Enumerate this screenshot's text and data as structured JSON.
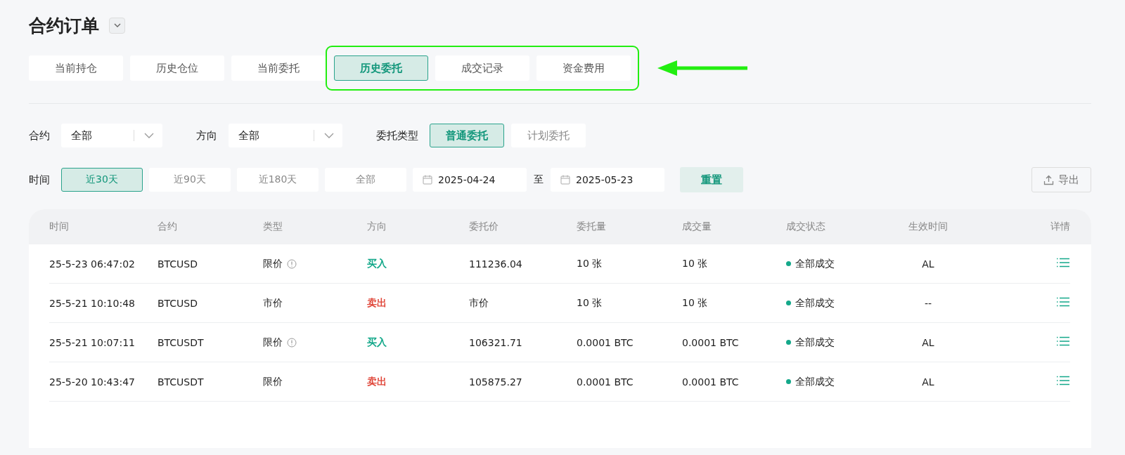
{
  "page_title": "合约订单",
  "tabs": [
    {
      "label": "当前持仓",
      "selected": false,
      "highlighted": false
    },
    {
      "label": "历史仓位",
      "selected": false,
      "highlighted": false
    },
    {
      "label": "当前委托",
      "selected": false,
      "highlighted": false
    },
    {
      "label": "历史委托",
      "selected": true,
      "highlighted": true
    },
    {
      "label": "成交记录",
      "selected": false,
      "highlighted": true
    },
    {
      "label": "资金费用",
      "selected": false,
      "highlighted": true
    }
  ],
  "filters": {
    "contract": {
      "label": "合约",
      "value": "全部"
    },
    "direction": {
      "label": "方向",
      "value": "全部"
    },
    "order_type": {
      "label": "委托类型",
      "options": [
        {
          "label": "普通委托",
          "selected": true
        },
        {
          "label": "计划委托",
          "selected": false
        }
      ]
    }
  },
  "time_filter": {
    "label": "时间",
    "options": [
      {
        "label": "近30天",
        "selected": true
      },
      {
        "label": "近90天",
        "selected": false
      },
      {
        "label": "近180天",
        "selected": false
      },
      {
        "label": "全部",
        "selected": false
      }
    ],
    "start_date": "2025-04-24",
    "separator": "至",
    "end_date": "2025-05-23",
    "reset": "重置",
    "export": "导出"
  },
  "table": {
    "columns": [
      "时间",
      "合约",
      "类型",
      "方向",
      "委托价",
      "委托量",
      "成交量",
      "成交状态",
      "生效时间",
      "详情"
    ],
    "rows": [
      {
        "time": "25-5-23 06:47:02",
        "contract": "BTCUSD",
        "type": "限价",
        "info": true,
        "direction": "买入",
        "kind": "buy",
        "price": "111236.04",
        "amount": "10 张",
        "filled": "10 张",
        "status": "全部成交",
        "color": "#14a88a",
        "effective": "AL"
      },
      {
        "time": "25-5-21 10:10:48",
        "contract": "BTCUSD",
        "type": "市价",
        "info": false,
        "direction": "卖出",
        "kind": "sell",
        "price": "市价",
        "amount": "10 张",
        "filled": "10 张",
        "status": "全部成交",
        "color": "#14a88a",
        "effective": "--"
      },
      {
        "time": "25-5-21 10:07:11",
        "contract": "BTCUSDT",
        "type": "限价",
        "info": true,
        "direction": "买入",
        "kind": "buy",
        "price": "106321.71",
        "amount": "0.0001 BTC",
        "filled": "0.0001 BTC",
        "status": "全部成交",
        "color": "#14a88a",
        "effective": "AL"
      },
      {
        "time": "25-5-20 10:43:47",
        "contract": "BTCUSDT",
        "type": "限价",
        "info": false,
        "direction": "卖出",
        "kind": "sell",
        "price": "105875.27",
        "amount": "0.0001 BTC",
        "filled": "0.0001 BTC",
        "status": "全部成交",
        "color": "#14a88a",
        "effective": "AL"
      }
    ]
  }
}
